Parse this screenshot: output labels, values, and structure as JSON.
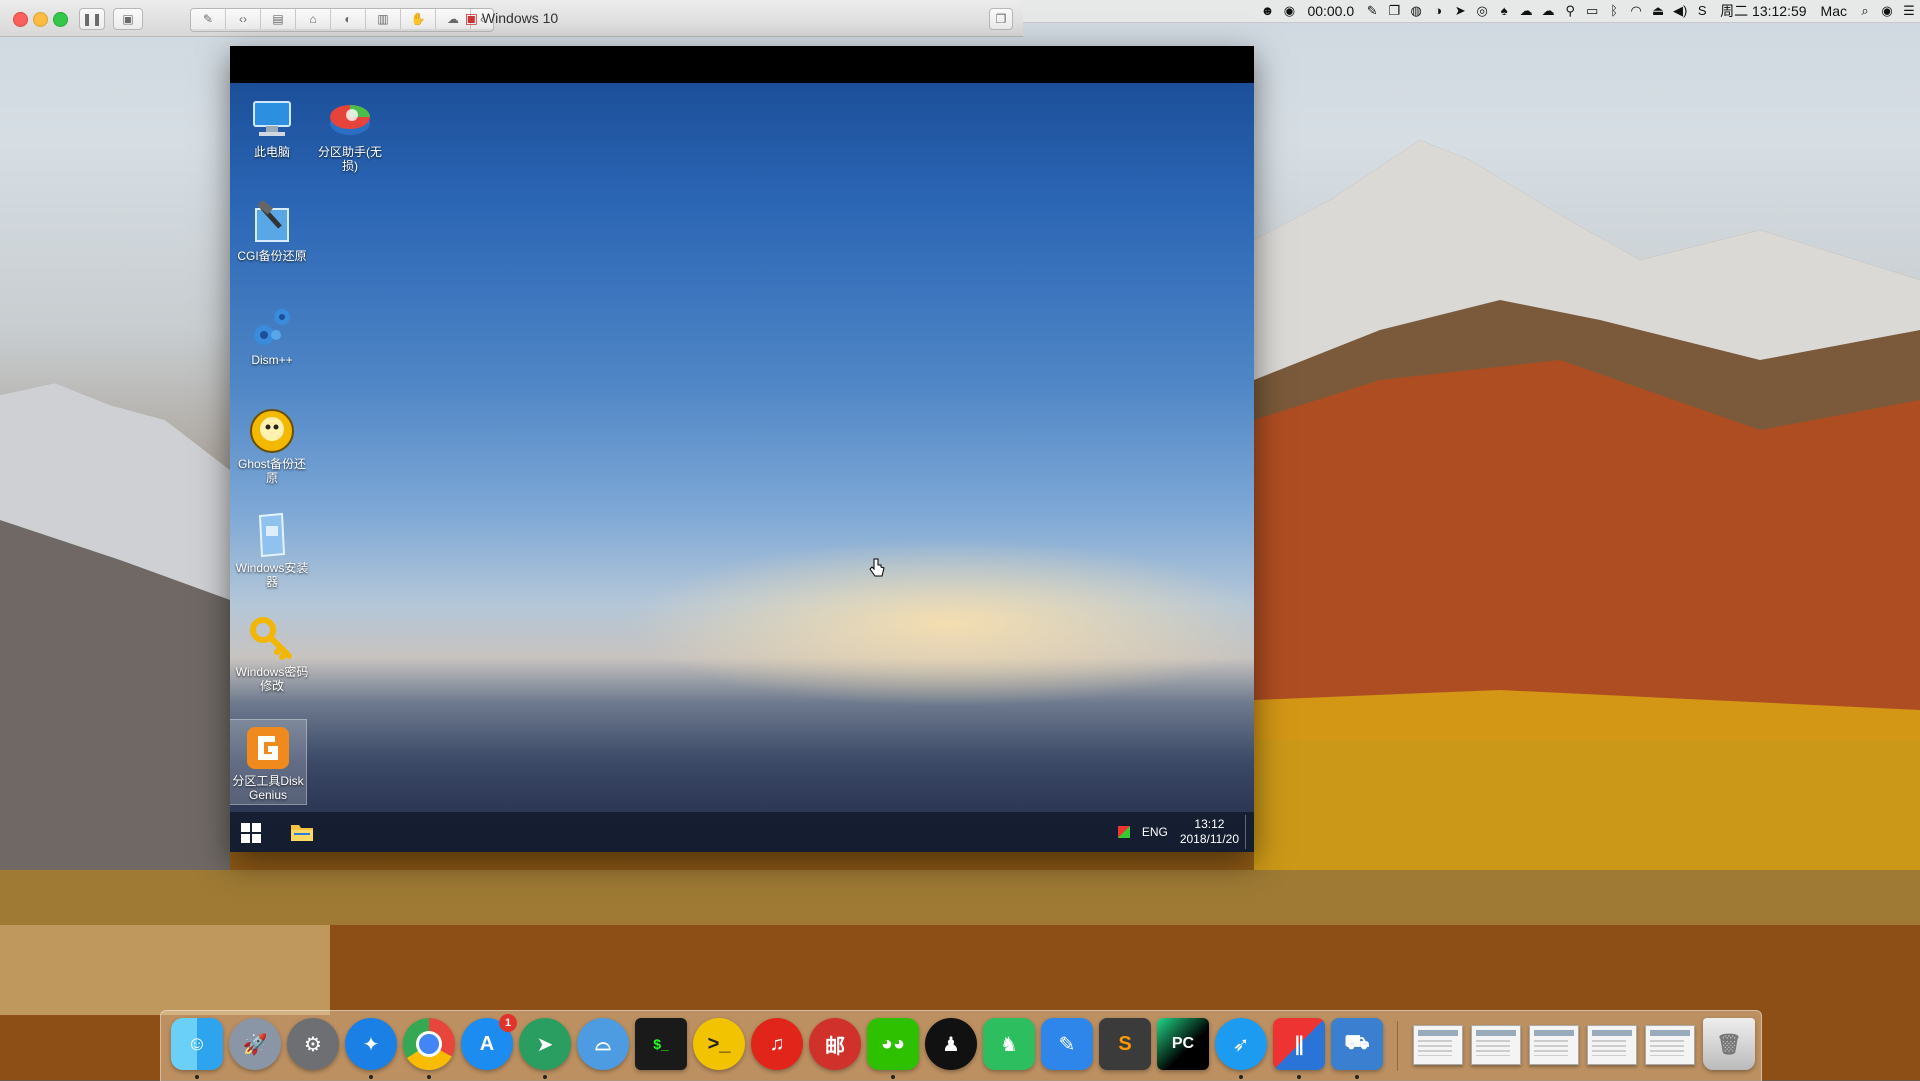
{
  "parallels": {
    "window_title": "Windows 10",
    "toolbar": [
      "wrench-icon",
      "code-icon",
      "drive-icon",
      "usb-icon",
      "audio-icon",
      "printer-icon",
      "bluetooth-icon",
      "share-icon"
    ]
  },
  "menubar": {
    "record_time": "00:00.0",
    "clock": "周二 13:12:59",
    "user": "Mac"
  },
  "windows": {
    "desktop_icons": [
      {
        "label": "此电脑",
        "icon": "computer-icon"
      },
      {
        "label": "分区助手(无损)",
        "icon": "partition-assistant-icon"
      },
      {
        "label": "CGI备份还原",
        "icon": "cgi-backup-icon"
      },
      {
        "label": "Dism++",
        "icon": "dism-icon"
      },
      {
        "label": "Ghost备份还原",
        "icon": "ghost-icon"
      },
      {
        "label": "Windows安装器",
        "icon": "windows-installer-icon"
      },
      {
        "label": "Windows密码修改",
        "icon": "key-icon"
      },
      {
        "label": "分区工具DiskGenius",
        "icon": "diskgenius-icon"
      }
    ],
    "taskbar": {
      "lang": "ENG",
      "time": "13:12",
      "date": "2018/11/20"
    }
  },
  "dock": {
    "apps": [
      "Finder",
      "Launchpad",
      "System Preferences",
      "Safari",
      "Chrome",
      "App Store",
      "Telegram",
      "Migrate",
      "Terminal",
      "Xshell",
      "NetEase Music",
      "Mail",
      "WeChat",
      "QQ",
      "Evernote",
      "Notes",
      "Sublime Text",
      "PyCharm",
      "Feishu",
      "Parallels",
      "Transmit",
      "Trash"
    ],
    "app_store_badge": "1"
  },
  "colors": {
    "traffic_red": "#fc605c",
    "traffic_yellow": "#fdbc40",
    "traffic_green": "#34c84a"
  }
}
